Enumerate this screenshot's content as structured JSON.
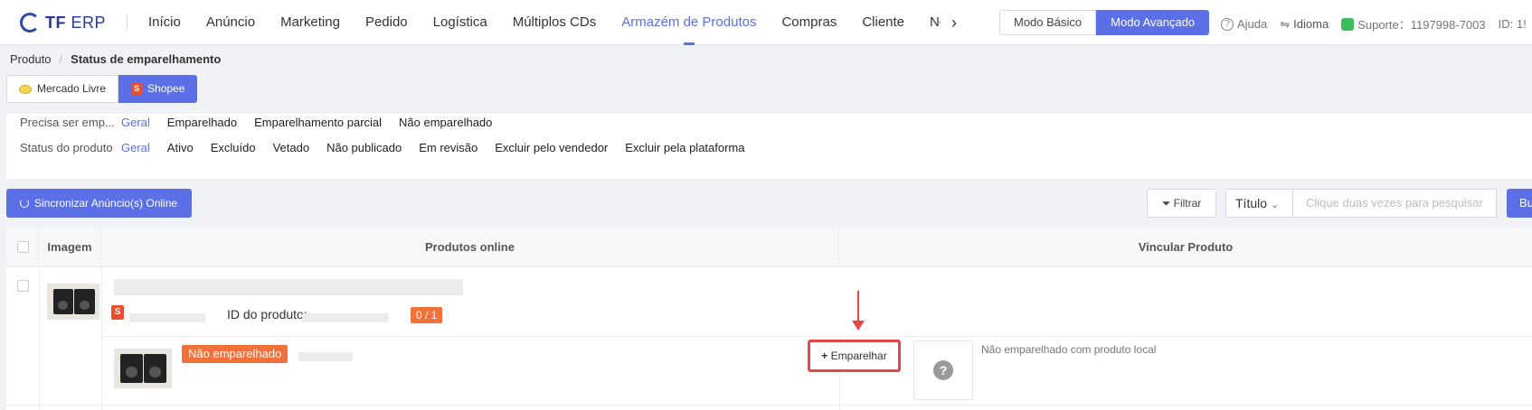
{
  "app": {
    "logo_bold": "TF",
    "logo_rest": " ERP"
  },
  "nav": {
    "items": [
      "Início",
      "Anúncio",
      "Marketing",
      "Pedido",
      "Logística",
      "Múltiplos CDs",
      "Armazém de Produtos",
      "Compras",
      "Cliente",
      "Nota Fisc"
    ],
    "active_index": 6,
    "next_icon": "chevron-right-icon"
  },
  "mode": {
    "basic": "Modo Básico",
    "advanced": "Modo Avançado",
    "active": "advanced"
  },
  "top_right": {
    "help": "Ajuda",
    "language": "Idioma",
    "support": "Suporte：1197998-7003",
    "id": "ID: 1!"
  },
  "breadcrumb": {
    "parent": "Produto",
    "separator": "/",
    "current": "Status de emparelhamento"
  },
  "platforms": [
    {
      "label": "Mercado Livre",
      "icon": "mercadolivre-icon",
      "selected": false
    },
    {
      "label": "Shopee",
      "icon": "shopee-icon",
      "selected": true
    }
  ],
  "filters": {
    "pairing": {
      "label": "Precisa ser emp...",
      "options": [
        "Geral",
        "Emparelhado",
        "Emparelhamento parcial",
        "Não emparelhado"
      ],
      "selected_index": 0
    },
    "status": {
      "label": "Status do produto",
      "options": [
        "Geral",
        "Ativo",
        "Excluído",
        "Vetado",
        "Não publicado",
        "Em revisão",
        "Excluir pelo vendedor",
        "Excluir pela plataforma"
      ],
      "selected_index": 0
    }
  },
  "toolbar": {
    "sync_label": "Sincronizar Anúncio(s) Online",
    "filter_label": "Filtrar",
    "search_field": "Título",
    "search_placeholder": "Clique duas vezes para pesquisar",
    "search_button": "Bu"
  },
  "table": {
    "headers": {
      "image": "Imagem",
      "online": "Produtos online",
      "link": "Vincular Produto"
    },
    "rows": [
      {
        "product_id_label": "ID do produto:",
        "pair_count": "0 / 1",
        "variant_status": "Não emparelhado",
        "pair_button": "Emparelhar",
        "link_status": "Não emparelhado com produto local"
      }
    ]
  },
  "colors": {
    "accent": "#5b6fe6",
    "warning": "#f2713a",
    "highlight": "#e64646"
  }
}
